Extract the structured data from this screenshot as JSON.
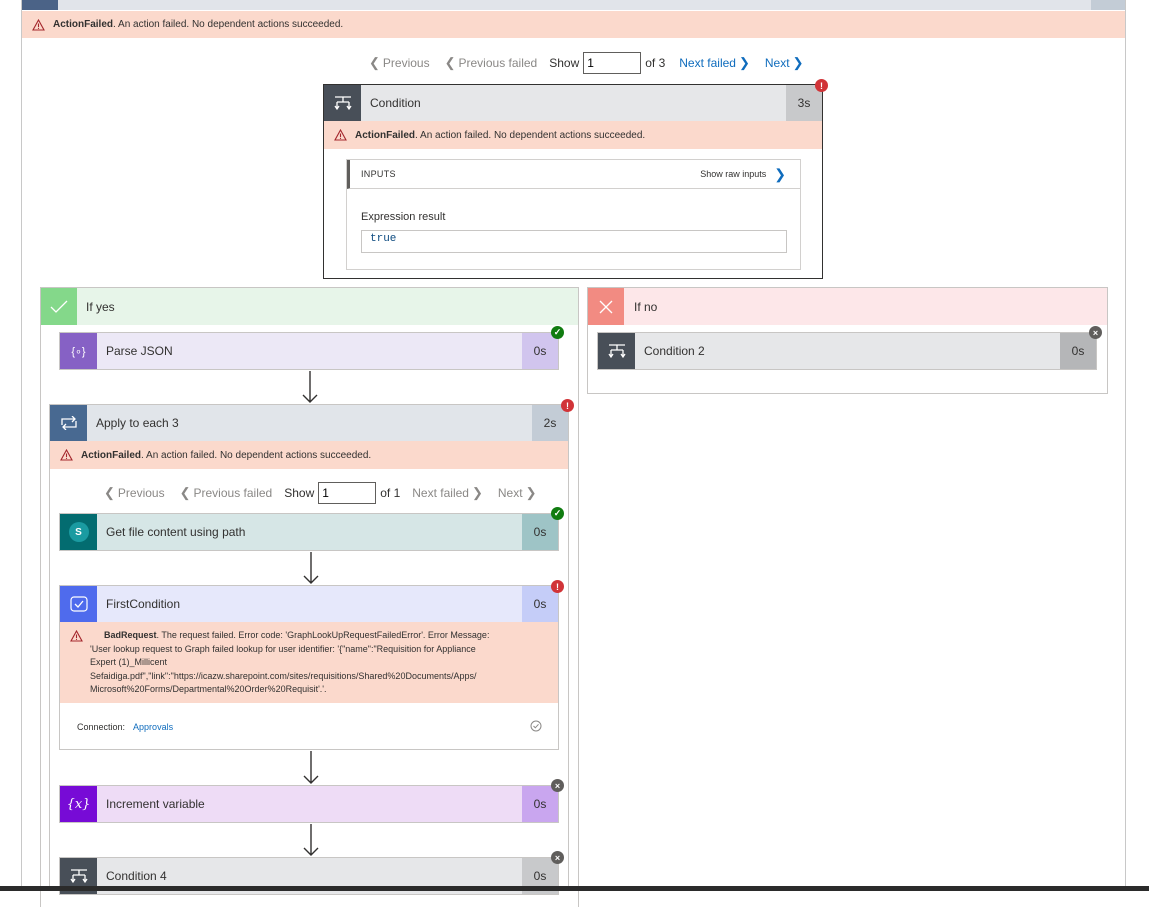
{
  "top_error": {
    "code": "ActionFailed",
    "message": ". An action failed. No dependent actions succeeded."
  },
  "top_pager": {
    "previous": "Previous",
    "previous_failed": "Previous failed",
    "show": "Show",
    "value": "1",
    "of": "of 3",
    "next_failed": "Next failed",
    "next": "Next"
  },
  "condition": {
    "title": "Condition",
    "duration": "3s",
    "error_code": "ActionFailed",
    "error_message": ". An action failed. No dependent actions succeeded.",
    "inputs_label": "INPUTS",
    "show_raw": "Show raw inputs",
    "expr_label": "Expression result",
    "expr_value": "true"
  },
  "if_yes": {
    "label": "If yes"
  },
  "if_no": {
    "label": "If no"
  },
  "parse_json": {
    "title": "Parse JSON",
    "duration": "0s"
  },
  "condition2": {
    "title": "Condition 2",
    "duration": "0s"
  },
  "apply_each": {
    "title": "Apply to each 3",
    "duration": "2s",
    "error_code": "ActionFailed",
    "error_message": ". An action failed. No dependent actions succeeded.",
    "pager": {
      "previous": "Previous",
      "previous_failed": "Previous failed",
      "show": "Show",
      "value": "1",
      "of": "of 1",
      "next_failed": "Next failed",
      "next": "Next"
    }
  },
  "get_file": {
    "title": "Get file content using path",
    "duration": "0s",
    "icon_letter": "S"
  },
  "first_condition": {
    "title": "FirstCondition",
    "duration": "0s",
    "error_code": "BadRequest",
    "error_line1": ". The request failed. Error code: 'GraphLookUpRequestFailedError'. Error Message:",
    "error_line2": "'User lookup request to Graph failed lookup for user identifier: '{\"name\":\"Requisition for Appliance",
    "error_line3": "Expert (1)_Millicent",
    "error_line4": "Sefaidiga.pdf\",\"link\":\"https://icazw.sharepoint.com/sites/requisitions/Shared%20Documents/Apps/",
    "error_line5": "Microsoft%20Forms/Departmental%20Order%20Requisit'.'.",
    "connection_label": "Connection:",
    "connection_value": "Approvals"
  },
  "increment": {
    "title": "Increment variable",
    "duration": "0s",
    "icon_text": "{x}"
  },
  "condition4": {
    "title": "Condition 4",
    "duration": "0s"
  },
  "colors": {
    "error_bg": "#fbd9cc",
    "condition_dark": "#484f58",
    "yes_green": "#84d88a",
    "no_red": "#f28b82",
    "parse_purple": "#8661c5",
    "loop_blue": "#486991",
    "sharepoint_teal": "#036c70",
    "approval_blue": "#4f6bed",
    "variable_purple": "#770bd6",
    "link_blue": "#0f6cbd"
  }
}
